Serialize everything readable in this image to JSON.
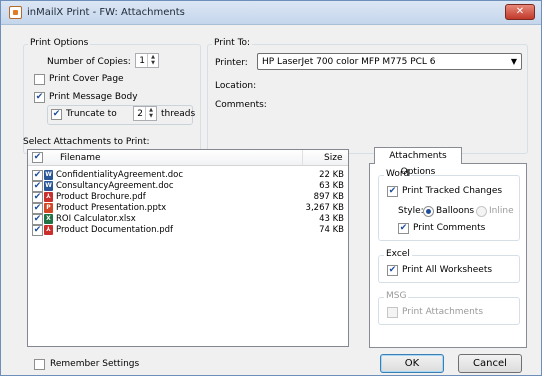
{
  "window": {
    "title": "inMailX Print - FW: Attachments",
    "close_label": "✕"
  },
  "print_options": {
    "label": "Print Options",
    "copies_label": "Number of Copies:",
    "copies_value": "1",
    "cover_page_label": "Print Cover Page",
    "cover_page_checked": false,
    "message_body_label": "Print Message Body",
    "message_body_checked": true,
    "truncate_label": "Truncate to",
    "truncate_checked": true,
    "truncate_value": "2",
    "threads_label": "threads"
  },
  "print_to": {
    "label": "Print To:",
    "printer_label": "Printer:",
    "printer_value": "HP LaserJet 700 color MFP M775 PCL 6",
    "location_label": "Location:",
    "comments_label": "Comments:"
  },
  "attachments": {
    "section_label": "Select Attachments to Print:",
    "columns": {
      "filename": "Filename",
      "size": "Size"
    },
    "rows": [
      {
        "name": "ConfidentialityAgreement.doc",
        "size": "22 KB",
        "type": "word"
      },
      {
        "name": "ConsultancyAgreement.doc",
        "size": "63 KB",
        "type": "word"
      },
      {
        "name": "Product Brochure.pdf",
        "size": "897 KB",
        "type": "pdf"
      },
      {
        "name": "Product Presentation.pptx",
        "size": "3,267 KB",
        "type": "ppt"
      },
      {
        "name": "ROI Calculator.xlsx",
        "size": "43 KB",
        "type": "excel"
      },
      {
        "name": "Product Documentation.pdf",
        "size": "74 KB",
        "type": "pdf"
      }
    ]
  },
  "options_tab": {
    "tab_label": "Attachments Options",
    "word": {
      "label": "Word",
      "tracked_changes_label": "Print Tracked Changes",
      "style_label": "Style:",
      "balloons_label": "Balloons",
      "inline_label": "Inline",
      "comments_label": "Print Comments"
    },
    "excel": {
      "label": "Excel",
      "worksheets_label": "Print All Worksheets"
    },
    "msg": {
      "label": "MSG",
      "attachments_label": "Print Attachments"
    }
  },
  "footer": {
    "remember_label": "Remember Settings",
    "ok_label": "OK",
    "cancel_label": "Cancel"
  },
  "icons": {
    "word": {
      "name": "word-doc-icon",
      "color": "#2b5797",
      "glyph": "W"
    },
    "pdf": {
      "name": "pdf-icon",
      "color": "#c9302c",
      "glyph": "⅄"
    },
    "ppt": {
      "name": "powerpoint-icon",
      "color": "#d24726",
      "glyph": "P"
    },
    "excel": {
      "name": "excel-icon",
      "color": "#217346",
      "glyph": "X"
    }
  }
}
